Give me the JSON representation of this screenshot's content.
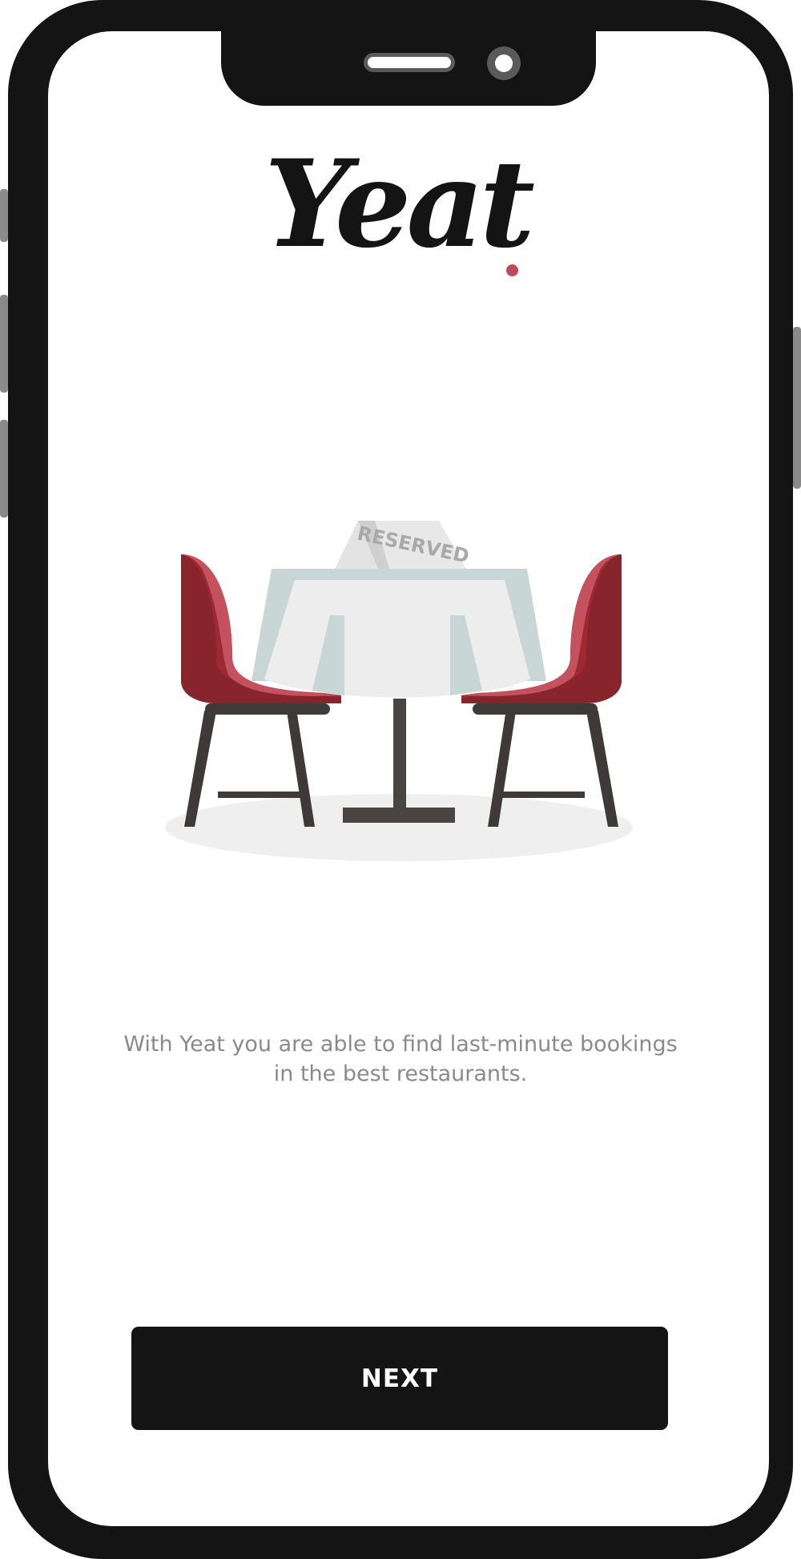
{
  "app": {
    "brand_name": "Yeat",
    "brand_dot_color": "#c0485a"
  },
  "illustration": {
    "sign_text": "RESERVED",
    "chair_color": "#9b2a33",
    "tablecloth_color": "#ecedec"
  },
  "onboarding": {
    "description": "With Yeat you are able to find last-minute bookings in the best restaurants.",
    "next_label": "NEXT"
  }
}
